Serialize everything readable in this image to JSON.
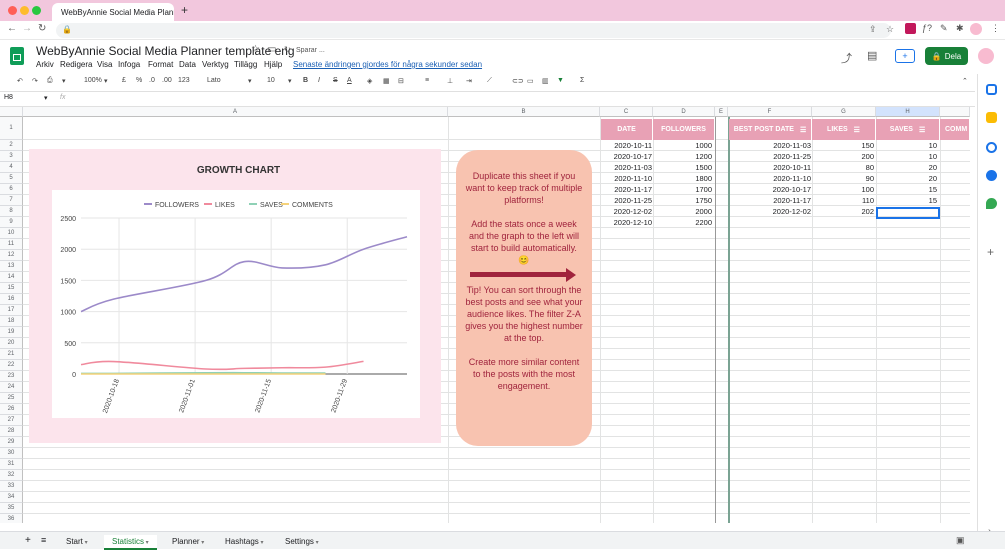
{
  "browser": {
    "tab_title": "WebByAnnie Social Media Planner",
    "new_tab": "+"
  },
  "doc": {
    "title": "WebByAnnie Social Media Planner template eng",
    "saving": "Sparar ...",
    "last_edit": "Senaste ändringen gjordes för några sekunder sedan",
    "share_label": "Dela",
    "menus": [
      "Arkiv",
      "Redigera",
      "Visa",
      "Infoga",
      "Format",
      "Data",
      "Verktyg",
      "Tillägg",
      "Hjälp"
    ]
  },
  "toolbar": {
    "zoom": "100%",
    "currency": "£",
    "percent": "%",
    "dec_less": ".0",
    "dec_more": ".00",
    "format_more": "123",
    "font": "Lato",
    "font_size": "10",
    "bold": "B",
    "italic": "I",
    "strike": "S",
    "text_color": "A",
    "sum": "Σ"
  },
  "formula": {
    "cell_ref": "H8",
    "fx": "fx"
  },
  "columns": [
    "A",
    "B",
    "C",
    "D",
    "E",
    "F",
    "G",
    "H"
  ],
  "rows": [
    "1",
    "2",
    "3",
    "4",
    "5",
    "6",
    "7",
    "8",
    "9",
    "10",
    "11",
    "12",
    "13",
    "14",
    "15",
    "16",
    "17",
    "18",
    "19",
    "20",
    "21",
    "22",
    "23",
    "24",
    "25",
    "26",
    "27",
    "28",
    "29",
    "30",
    "31",
    "32",
    "33",
    "34",
    "35",
    "36"
  ],
  "table_headers": {
    "date": "DATE",
    "followers": "FOLLOWERS",
    "best_post_date": "BEST POST DATE",
    "likes": "LIKES",
    "saves": "SAVES",
    "comments": "COMM"
  },
  "followers_table": [
    {
      "date": "2020-10-11",
      "followers": "1000"
    },
    {
      "date": "2020-10-17",
      "followers": "1200"
    },
    {
      "date": "2020-11-03",
      "followers": "1500"
    },
    {
      "date": "2020-11-10",
      "followers": "1800"
    },
    {
      "date": "2020-11-17",
      "followers": "1700"
    },
    {
      "date": "2020-11-25",
      "followers": "1750"
    },
    {
      "date": "2020-12-02",
      "followers": "2000"
    },
    {
      "date": "2020-12-10",
      "followers": "2200"
    }
  ],
  "posts_table": [
    {
      "date": "2020-11-03",
      "likes": "150",
      "saves": "10"
    },
    {
      "date": "2020-11-25",
      "likes": "200",
      "saves": "10"
    },
    {
      "date": "2020-10-11",
      "likes": "80",
      "saves": "20"
    },
    {
      "date": "2020-11-10",
      "likes": "90",
      "saves": "20"
    },
    {
      "date": "2020-10-17",
      "likes": "100",
      "saves": "15"
    },
    {
      "date": "2020-11-17",
      "likes": "110",
      "saves": "15"
    },
    {
      "date": "2020-12-02",
      "likes": "202",
      "saves": ""
    }
  ],
  "note": {
    "p1": "Duplicate this sheet if you want to keep track of multiple platforms!",
    "p2": "Add the stats once a week and the graph to the left will start to build automatically.",
    "emoji": "😊",
    "p3": "Tip! You can sort through the best posts and see what your audience likes. The filter Z-A gives you the highest number at the top.",
    "p4": "Create more similar content to the posts with the most engagement."
  },
  "colors": {
    "followers": "#9c8ac9",
    "likes": "#f08a9d",
    "saves": "#8fd1b6",
    "comments": "#f5d27a",
    "header_pink": "#e8a1b5",
    "note_bg": "#f8c3b0",
    "note_text": "#a0243d"
  },
  "chart_data": {
    "type": "line",
    "title": "GROWTH CHART",
    "x": [
      "2020-10-11",
      "2020-10-17",
      "2020-11-03",
      "2020-11-10",
      "2020-11-17",
      "2020-11-25",
      "2020-12-02",
      "2020-12-10"
    ],
    "xticks": [
      "2020-10-18",
      "2020-11-01",
      "2020-11-15",
      "2020-11-29"
    ],
    "ylim": [
      0,
      2500
    ],
    "yticks": [
      0,
      500,
      1000,
      1500,
      2000,
      2500
    ],
    "legend_position": "top",
    "grid": true,
    "series": [
      {
        "name": "FOLLOWERS",
        "values": [
          1000,
          1200,
          1500,
          1800,
          1700,
          1750,
          2000,
          2200
        ]
      },
      {
        "name": "LIKES",
        "values": [
          150,
          200,
          80,
          90,
          100,
          110,
          202,
          null
        ]
      },
      {
        "name": "SAVES",
        "values": [
          10,
          10,
          20,
          20,
          15,
          15,
          null,
          null
        ]
      },
      {
        "name": "COMMENTS",
        "values": [
          0,
          0,
          0,
          0,
          0,
          0,
          null,
          null
        ]
      }
    ]
  },
  "sheet_tabs": [
    "Start",
    "Statistics",
    "Planner",
    "Hashtags",
    "Settings"
  ],
  "active_sheet": "Statistics"
}
